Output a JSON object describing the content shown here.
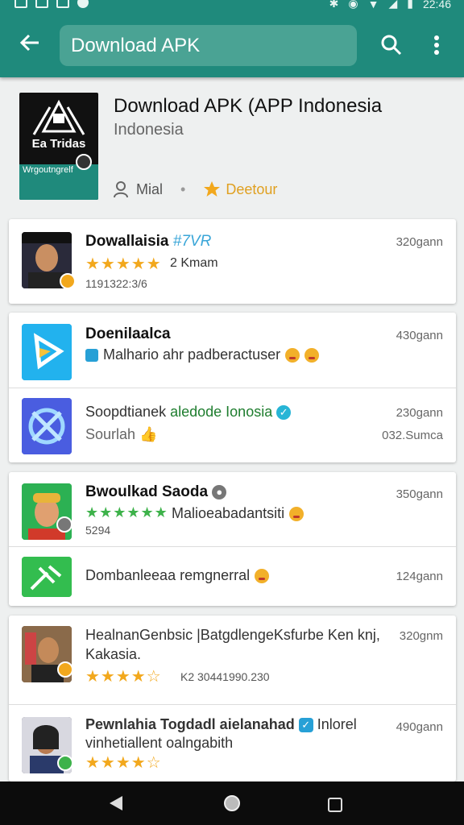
{
  "status": {
    "time": "22:46"
  },
  "search": {
    "query": "Download APK"
  },
  "header": {
    "title": "Download APK (APP Indonesia",
    "subtitle": "Indonesia",
    "author": "Mial",
    "developer": "Deetour",
    "logo_text": "Ea Tridas",
    "logo_tagline": "Wrgoutngrelf"
  },
  "cards": [
    {
      "rows": [
        {
          "title": "Dowallaisia",
          "title_tag": "#7VR",
          "size": "320gann",
          "stars": "★★★★★",
          "rating_text": "2 Kmam",
          "meta": "1191322:3/6"
        }
      ]
    },
    {
      "rows": [
        {
          "title": "Doenilaalca",
          "size": "430gann",
          "desc": "Malhario ahr padberactuser"
        },
        {
          "title": "Soopdtianek",
          "title_green": "aledode Ionosia",
          "size": "230gann",
          "sub": "Sourlah",
          "sub_right": "032.Sumca"
        }
      ]
    },
    {
      "rows": [
        {
          "title": "Bwoulkad Saoda",
          "size": "350gann",
          "stars": "★★★★★★",
          "desc": "Malioeabadantsiti",
          "meta": "5294"
        },
        {
          "line": "Dombanleeaa remgnerral",
          "size": "124gann"
        }
      ]
    },
    {
      "rows": [
        {
          "title": "HealnanGenbsic |BatgdlengeKsfurbe Ken knj,",
          "title2": "Kakasia.",
          "size": "320gnm",
          "stars": "★★★★☆",
          "meta": "K2 30441990.230"
        },
        {
          "title": "Pewnlahia Togdadl aielanahad",
          "title_tail": "Inlorel",
          "title2": "vinhetiallent oalngabith",
          "size": "490gann",
          "stars": "★★★★☆"
        }
      ]
    }
  ]
}
